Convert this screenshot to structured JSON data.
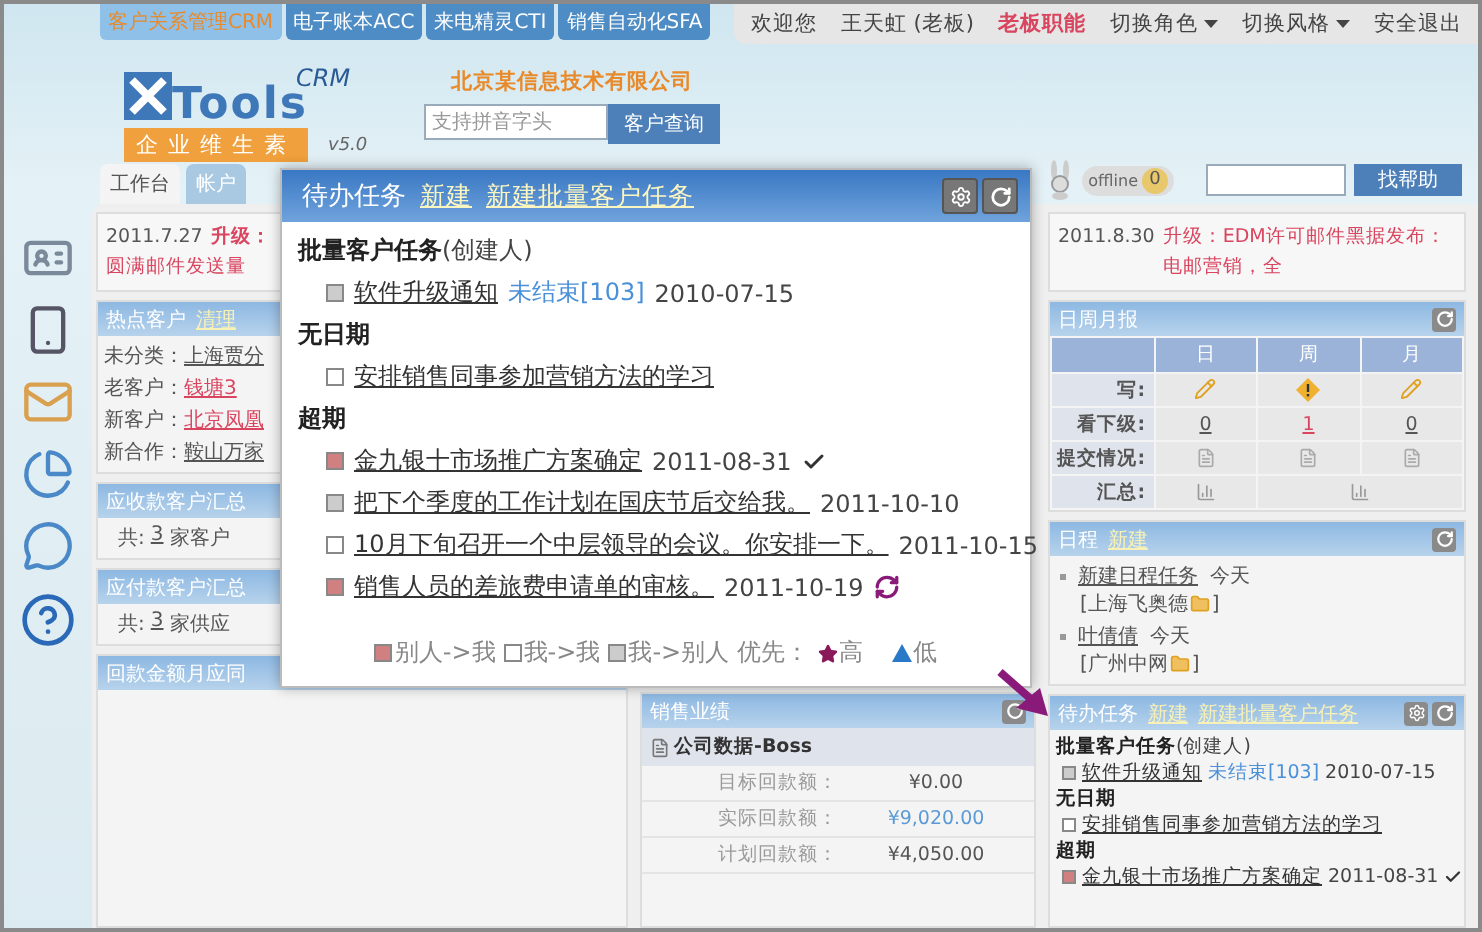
{
  "product_tabs": [
    {
      "label": "客户关系管理CRM",
      "selected": true
    },
    {
      "label": "电子账本ACC",
      "selected": false
    },
    {
      "label": "来电精灵CTI",
      "selected": false
    },
    {
      "label": "销售自动化SFA",
      "selected": false
    }
  ],
  "user_bar": {
    "greeting": "欢迎您",
    "user": "王天虹 (老板)",
    "role": "老板职能",
    "menus": [
      "切换角色",
      "切换风格"
    ],
    "logout": "安全退出"
  },
  "logo": {
    "name": "Tools",
    "crm": "CRM",
    "slogan": "企业维生素",
    "version": "v5.0"
  },
  "company": "北京某信息技术有限公司",
  "customer_search": {
    "placeholder": "支持拼音字头",
    "button": "客户查询"
  },
  "presence": {
    "label": "offline",
    "count": "0"
  },
  "help_search": {
    "button": "找帮助"
  },
  "tabs": [
    {
      "label": "工作台",
      "selected": true
    },
    {
      "label": "帐户",
      "selected": false
    }
  ],
  "left_notice": {
    "date": "2011.7.27",
    "tag": "升级：",
    "text": "圆满邮件发送量"
  },
  "hot_customers": {
    "title": "热点客户",
    "action": "清理",
    "rows": [
      {
        "label": "未分类：",
        "value": "上海贾分"
      },
      {
        "label": "老客户：",
        "value": "钱塘3"
      },
      {
        "label": "新客户：",
        "value": "北京凤凰"
      },
      {
        "label": "新合作：",
        "value": "鞍山万家"
      }
    ]
  },
  "summaries": [
    {
      "title": "应收款客户汇总",
      "prefix": "共:",
      "count": "3",
      "suffix": "家客户"
    },
    {
      "title": "应付款客户汇总",
      "prefix": "共:",
      "count": "3",
      "suffix": "家供应"
    }
  ],
  "receipt_panel": {
    "title": "回款金额月应同"
  },
  "sales": {
    "title": "销售业绩",
    "group": "公司数据-Boss",
    "rows": [
      {
        "label": "目标回款额：",
        "value": "¥0.00",
        "highlight": false
      },
      {
        "label": "实际回款额：",
        "value": "¥9,020.00",
        "highlight": true
      },
      {
        "label": "计划回款额：",
        "value": "¥4,050.00",
        "highlight": false
      }
    ]
  },
  "right_notice": {
    "date": "2011.8.30",
    "tag": "升级：",
    "text": "EDM许可邮件黑据发布：电邮营销，全"
  },
  "report": {
    "title": "日周月报",
    "columns": [
      "日",
      "周",
      "月"
    ],
    "rows": [
      {
        "label": "写:",
        "cells": [
          {
            "kind": "pencil"
          },
          {
            "kind": "warning"
          },
          {
            "kind": "pencil"
          }
        ]
      },
      {
        "label": "看下级:",
        "cells": [
          {
            "kind": "count",
            "text": "0",
            "alert": false
          },
          {
            "kind": "count",
            "text": "1",
            "alert": true
          },
          {
            "kind": "count",
            "text": "0",
            "alert": false
          }
        ]
      },
      {
        "label": "提交情况:",
        "cells": [
          {
            "kind": "doc"
          },
          {
            "kind": "doc"
          },
          {
            "kind": "doc"
          }
        ]
      },
      {
        "label": "汇总:",
        "cells": [
          {
            "kind": "summary"
          },
          {
            "kind": "summary"
          }
        ]
      }
    ]
  },
  "schedule": {
    "title": "日程",
    "action": "新建",
    "items": [
      {
        "title": "新建日程任务",
        "when": "今天",
        "client": "[上海飞奥德",
        "close": "]"
      },
      {
        "title": "叶倩倩",
        "when": "今天",
        "client": "[广州中网",
        "close": "]"
      }
    ]
  },
  "tasks_popup": {
    "title": "待办任务",
    "actions": [
      "新建",
      "新建批量客户任务"
    ],
    "sections": [
      {
        "heading": "批量客户任务",
        "note": "(创建人)",
        "items": [
          {
            "title": "软件升级通知",
            "status": "未结束[103]",
            "date": "2010-07-15",
            "kind": "outgoing"
          }
        ]
      },
      {
        "heading": "无日期",
        "items": [
          {
            "title": "安排销售同事参加营销方法的学习",
            "kind": "self"
          }
        ]
      },
      {
        "heading": "超期",
        "items": [
          {
            "title": "金九银十市场推广方案确定",
            "date": "2011-08-31",
            "kind": "incoming",
            "done": true
          },
          {
            "title": "把下个季度的工作计划在国庆节后交给我。",
            "date": "2011-10-10",
            "kind": "outgoing"
          },
          {
            "title": "10月下旬召开一个中层领导的会议。你安排一下。",
            "date": "2011-10-15",
            "kind": "self"
          },
          {
            "title": "销售人员的差旅费申请单的审核。",
            "date": "2011-10-19",
            "kind": "incoming",
            "recurring": true
          }
        ]
      }
    ],
    "legend": [
      {
        "kind": "incoming",
        "text": "别人->我"
      },
      {
        "kind": "self",
        "text": "我->我"
      },
      {
        "kind": "outgoing",
        "text": "我->别人"
      }
    ],
    "priority": {
      "label": "优先：",
      "high": "高",
      "low": "低"
    }
  },
  "tasks_panel": {
    "title": "待办任务",
    "actions": [
      "新建",
      "新建批量客户任务"
    ],
    "sections": [
      {
        "heading": "批量客户任务",
        "note": "(创建人)",
        "items": [
          {
            "title": "软件升级通知",
            "status": "未结束[103]",
            "date": "2010-07-15",
            "kind": "outgoing"
          }
        ]
      },
      {
        "heading": "无日期",
        "items": [
          {
            "title": "安排销售同事参加营销方法的学习",
            "kind": "self"
          }
        ]
      },
      {
        "heading": "超期",
        "items": [
          {
            "title": "金九银十市场推广方案确定",
            "date": "2011-08-31",
            "kind": "incoming",
            "done": true
          }
        ]
      }
    ]
  }
}
